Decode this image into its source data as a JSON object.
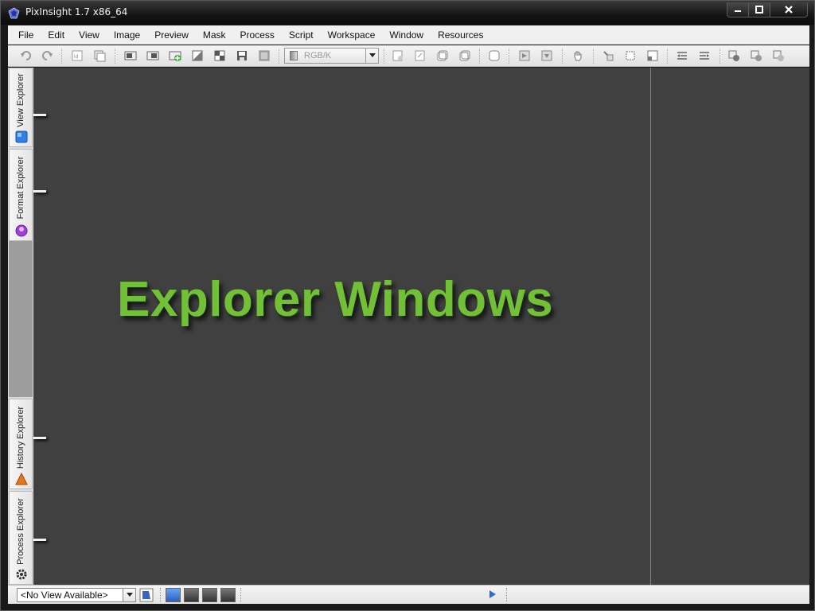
{
  "window": {
    "title": "PixInsight 1.7 x86_64",
    "controls": {
      "minimize": "minimize",
      "maximize": "maximize",
      "close": "close"
    }
  },
  "menubar": {
    "items": [
      "File",
      "Edit",
      "View",
      "Image",
      "Preview",
      "Mask",
      "Process",
      "Script",
      "Workspace",
      "Window",
      "Resources"
    ]
  },
  "toolbar": {
    "color_space": "RGB/K",
    "icons": [
      "undo-icon",
      "redo-icon",
      "identifier-icon",
      "clone-icon",
      "new-image-icon",
      "duplicate-icon",
      "add-image-icon",
      "invert-icon",
      "checker-icon",
      "save-icon",
      "grey-icon",
      "zoom-in-icon",
      "zoom-out-icon",
      "zoom-fit-icon",
      "zoom-actual-icon",
      "pan-icon",
      "readout-icon",
      "preview-new-icon",
      "preview-edit-icon",
      "preview-delete-icon",
      "hand-icon",
      "crop-icon",
      "select-icon",
      "select-2-icon",
      "mask-show-icon",
      "mask-hide-icon",
      "mask-invert-icon",
      "process-1-icon",
      "process-2-icon",
      "process-3-icon"
    ]
  },
  "sidebar": {
    "tabs": [
      {
        "label": "View Explorer",
        "icon": "view-explorer-icon",
        "color": "#2f7fe8"
      },
      {
        "label": "Format Explorer",
        "icon": "format-explorer-icon",
        "color": "#a040d8"
      },
      {
        "label": "History Explorer",
        "icon": "history-explorer-icon",
        "color": "#e8761a"
      },
      {
        "label": "Process Explorer",
        "icon": "process-explorer-icon",
        "color": "#3a3a3a"
      }
    ]
  },
  "workspace": {
    "headline": "Explorer Windows",
    "headline_color": "#72c035",
    "background": "#404040"
  },
  "statusbar": {
    "view_select": "<No View Available>",
    "swatch_colors": [
      "#3a78d8",
      "#4a4a4a",
      "#4a4a4a",
      "#4a4a4a"
    ]
  }
}
